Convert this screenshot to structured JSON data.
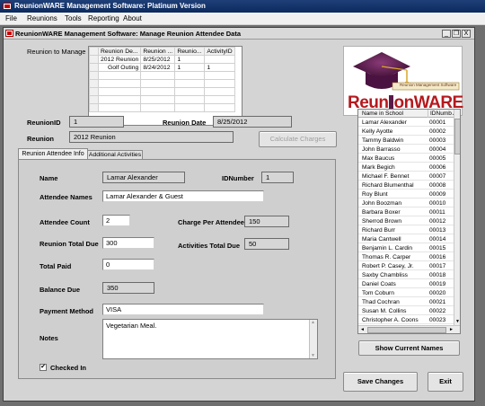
{
  "app": {
    "title": "ReunionWARE Management Software:   Platinum Version"
  },
  "menu": {
    "items": [
      "File",
      "Reunions",
      "Tools",
      "Reporting",
      "About"
    ]
  },
  "window": {
    "title": "ReunionWARE Management Software:  Manage Reunion Attendee Data",
    "min": "_",
    "restore": "❐",
    "close": "X"
  },
  "reunion_grid": {
    "label": "Reunion to Manage",
    "columns": [
      "Reunion De...",
      "Reunion ...",
      "Reunio...",
      "ActivityID"
    ],
    "rows": [
      [
        "2012 Reunion",
        "8/25/2012",
        "1",
        ""
      ],
      [
        "Golf Outing",
        "8/24/2012",
        "1",
        "1"
      ]
    ]
  },
  "logo": {
    "tagline": "Reunion Management Software",
    "word_left": "Reun",
    "word_right": "onWARE"
  },
  "reunion_info": {
    "reunion_id_label": "ReunionID",
    "reunion_id": "1",
    "reunion_date_label": "Reunion Date",
    "reunion_date": "8/25/2012",
    "reunion_label": "Reunion",
    "reunion": "2012 Reunion",
    "calc_button": "Calculate Charges"
  },
  "tabs": [
    {
      "label": "Reunion Attendee Info"
    },
    {
      "label": "Additional Activities"
    }
  ],
  "attendee": {
    "name_label": "Name",
    "name": "Lamar Alexander",
    "idnumber_label": "IDNumber",
    "idnumber": "1",
    "attendee_names_label": "Attendee Names",
    "attendee_names": "Lamar Alexander & Guest",
    "attendee_count_label": "Attendee Count",
    "attendee_count": "2",
    "charge_label": "Charge Per Attendee",
    "charge": "150",
    "total_due_label": "Reunion Total Due",
    "total_due": "300",
    "activities_due_label": "Activities Total Due",
    "activities_due": "50",
    "total_paid_label": "Total Paid",
    "total_paid": "0",
    "balance_label": "Balance Due",
    "balance": "350",
    "payment_label": "Payment Method",
    "payment": "VISA",
    "notes_label": "Notes",
    "notes": "Vegetarian Meal.",
    "checked_in_label": "Checked In",
    "checked_in_mark": "✔"
  },
  "names_list": {
    "headers": [
      "Name in School",
      "IDNumb▲"
    ],
    "rows": [
      [
        "Lamar Alexander",
        "00001"
      ],
      [
        "Kelly Ayotte",
        "00002"
      ],
      [
        "Tammy Baldwin",
        "00003"
      ],
      [
        "John Barrasso",
        "00004"
      ],
      [
        "Max Baucus",
        "00005"
      ],
      [
        "Mark Begich",
        "00006"
      ],
      [
        "Michael F. Bennet",
        "00007"
      ],
      [
        "Richard Blumenthal",
        "00008"
      ],
      [
        "Roy Blunt",
        "00009"
      ],
      [
        "John Boozman",
        "00010"
      ],
      [
        "Barbara Boxer",
        "00011"
      ],
      [
        "Sherrod Brown",
        "00012"
      ],
      [
        "Richard Burr",
        "00013"
      ],
      [
        "Maria Cantwell",
        "00014"
      ],
      [
        "Benjamin L. Cardin",
        "00015"
      ],
      [
        "Thomas R. Carper",
        "00016"
      ],
      [
        "Robert P. Casey, Jr.",
        "00017"
      ],
      [
        "Saxby Chambliss",
        "00018"
      ],
      [
        "Daniel Coats",
        "00019"
      ],
      [
        "Tom Coburn",
        "00020"
      ],
      [
        "Thad Cochran",
        "00021"
      ],
      [
        "Susan M. Collins",
        "00022"
      ],
      [
        "Christopher A. Coons",
        "00023"
      ]
    ],
    "show_button": "Show Current Names"
  },
  "actions": {
    "save": "Save Changes",
    "exit": "Exit"
  },
  "colors": {
    "titlebar": "#0c2a5e",
    "logo_red": "#b5191e",
    "logo_purple": "#5a1a48"
  }
}
